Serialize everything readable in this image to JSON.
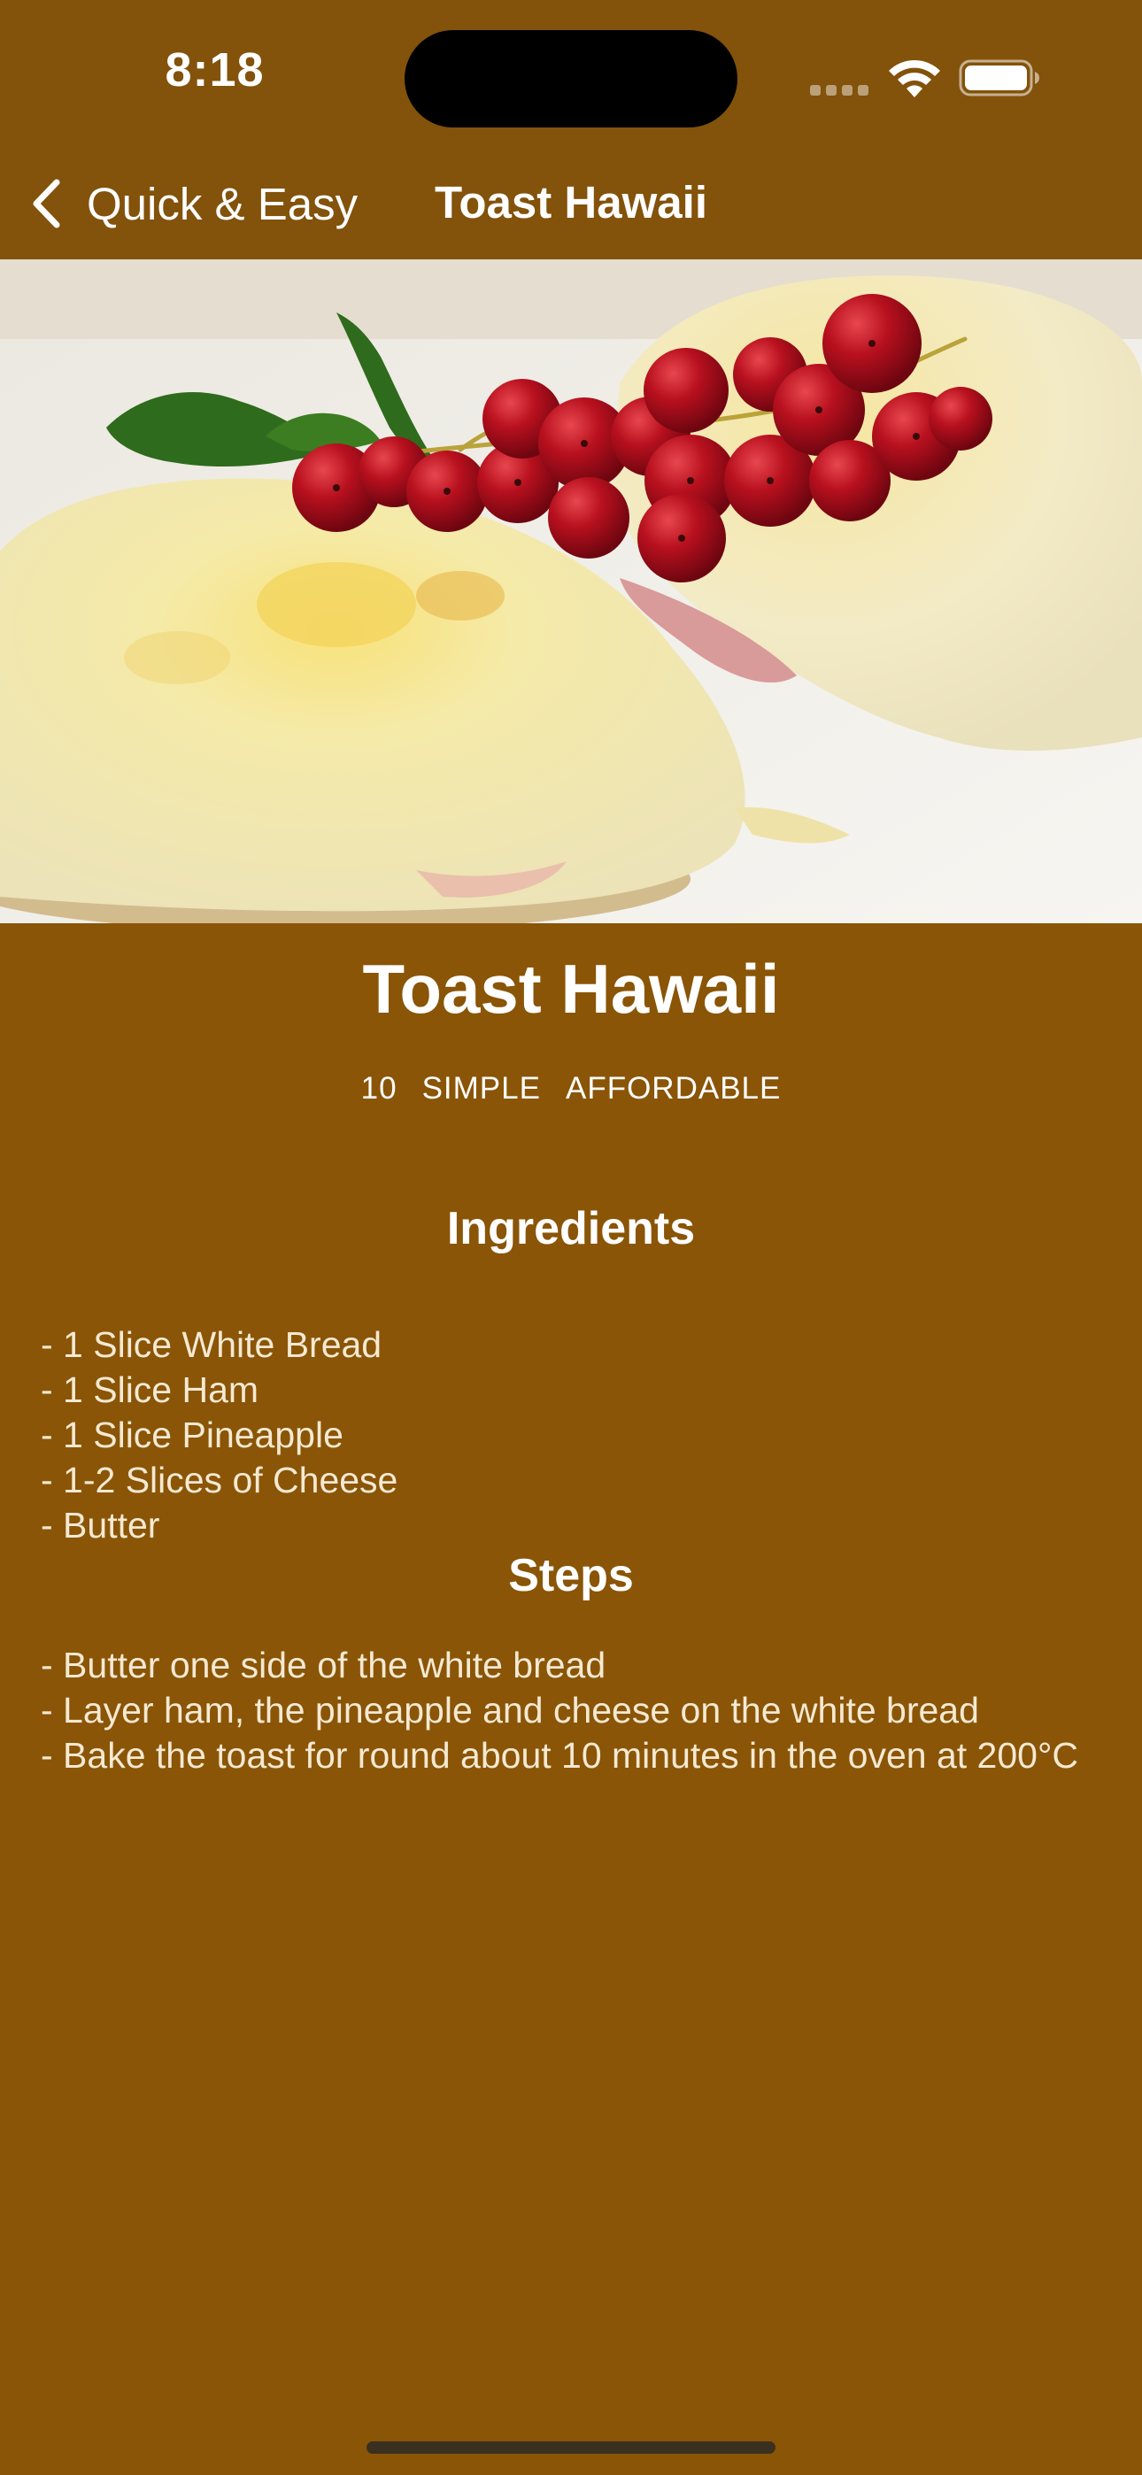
{
  "status_bar": {
    "time": "8:18"
  },
  "nav": {
    "back_label": "Quick & Easy",
    "title": "Toast Hawaii"
  },
  "recipe": {
    "title": "Toast Hawaii",
    "duration": "10",
    "complexity": "SIMPLE",
    "affordability": "AFFORDABLE",
    "ingredients_heading": "Ingredients",
    "ingredients": [
      "- 1 Slice White Bread",
      "- 1 Slice Ham",
      "- 1 Slice Pineapple",
      "- 1-2 Slices of Cheese",
      "- Butter"
    ],
    "steps_heading": "Steps",
    "steps": [
      "- Butter one side of the white bread",
      "- Layer ham, the pineapple and cheese on the white bread",
      "- Bake the toast for round about 10 minutes in the oven at 200°C"
    ]
  },
  "colors": {
    "background": "#8a5507",
    "header": "#83520b",
    "text": "#ffffff",
    "list_text": "#f5e9d2"
  }
}
